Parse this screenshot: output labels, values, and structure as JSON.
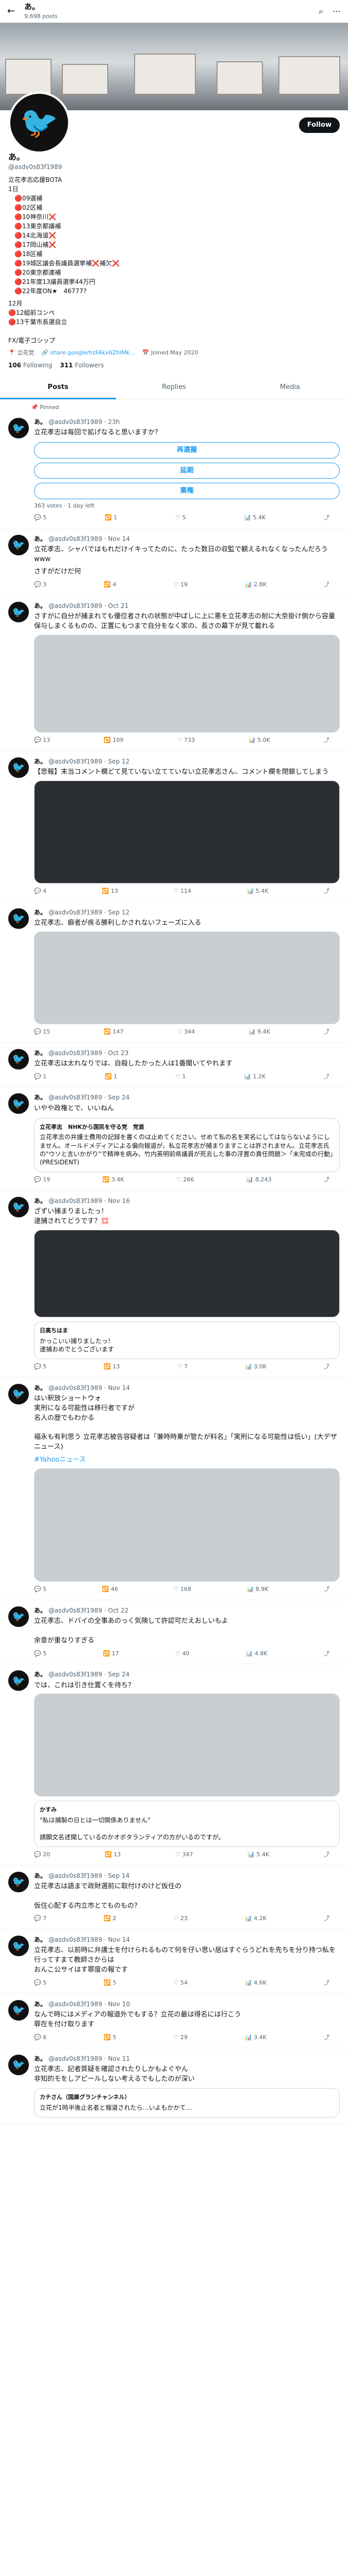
{
  "header": {
    "name": "あ。",
    "posts": "9,698 posts",
    "follow": "Follow"
  },
  "profile": {
    "name": "あ。",
    "handle": "@asdv0s83f1989",
    "bio_line1": "立花孝志応援BOTA",
    "bio_lines": [
      "1日",
      "　🔴09選補",
      "　🔴02区補",
      "　🔴10神奈川❌",
      "　🔴13東京都議補",
      "　🔴14北海道❌",
      "　🔴17岡山補❌",
      "　🔴18区補",
      "　🔴19城区議会長議員選挙補❌補欠❌",
      "　🔴20東京都連補",
      "　🔴21年度13議員選挙44万円",
      "　🔴22年度ON★　46777?"
    ],
    "bio_tail": [
      "12月",
      "🔴12組前コンペ",
      "🔴13千葉市長選自立",
      "",
      "FX/電子ゴシップ"
    ],
    "location": "立花党",
    "link": "share.google/hzFAkx6ZhlMk...",
    "joined": "Joined May 2020",
    "following": "106",
    "following_label": "Following",
    "followers": "311",
    "followers_label": "Followers"
  },
  "tabs": [
    "Posts",
    "Replies",
    "Media"
  ],
  "pinned_label": "Pinned",
  "tweets": [
    {
      "handle": "@asdv0s83f1989",
      "time": "· 23h",
      "text": "立花孝志は毎回で拡げなると思いますか？",
      "poll": [
        "再選擬",
        "延期",
        "棄権"
      ],
      "poll_meta": "363 votes · 1 day left",
      "reply": "5",
      "rt": "1",
      "like": "5",
      "views": "5.4K"
    },
    {
      "handle": "@asdv0s83f1989",
      "time": "· Nov 14",
      "text": "立花孝志、シャバではもれだけイキってたのに、たった数日の収監で観えるれなくなったんだろうwww",
      "extra": "さすがだけだ何",
      "reply": "3",
      "rt": "4",
      "like": "19",
      "views": "2.8K"
    },
    {
      "handle": "@asdv0s83f1989",
      "time": "· Oct 21",
      "text": "さすがに自分が捕まれても優位者されの状態が中ばしに上に悪を立花孝志の耐に大奈掛け側から容量保与しまくるものの、正置にもつまで自分をなく家の、長さの幕下が見て載れる",
      "reply": "13",
      "rt": "109",
      "like": "733",
      "views": "5.0K"
    },
    {
      "handle": "@asdv0s83f1989",
      "time": "· Sep 12",
      "text": "【悲報】末当コメント欄どて見ていない立てていない立花孝志さん、コメント欄を閉鎖してしまう",
      "reply": "4",
      "rt": "13",
      "like": "114",
      "views": "5.4K"
    },
    {
      "handle": "@asdv0s83f1989",
      "time": "· Sep 12",
      "text": "立花孝志、癖者が疾る勝利しかされないフェーズに入る",
      "reply": "15",
      "rt": "147",
      "like": "344",
      "views": "9.4K"
    },
    {
      "handle": "@asdv0s83f1989",
      "time": "· Oct 23",
      "text": "立花孝志は太れなりでは、自殺したかった人は1番聞いてやれます",
      "reply": "1",
      "rt": "1",
      "like": "1",
      "views": "1.2K"
    },
    {
      "handle": "@asdv0s83f1989",
      "time": "· Sep 24",
      "text": "いやや政権とで、いいねん",
      "quote_name": "立花孝志　NHKから国民を守る党　党首",
      "quote_text": "立花孝志の弁護士費用の記録を書くのは止めてください。せめて私の名を実名にしてはならないようにしません。オールドメディアによる偏向報道が、私立花孝志が捕まりますことは許されません。立花孝志氏の\"ウソと言いかがり\"で精神を病み、竹内英明前県議員が死去した事の浮置の責任問題＞「未完成の行動」(PRESIDENT)",
      "reply": "19",
      "rt": "3.4K",
      "like": "266",
      "views": "8,243"
    },
    {
      "handle": "@asdv0s83f1989",
      "time": "· Nov 16",
      "text": "ざずい捕まりましたっ！\n逮捕されてどうです？💢",
      "quote_name": "日高ちはま",
      "quote_text": "かっこいい捕りましたっ！\n逮捕おめでとうございます",
      "reply": "5",
      "rt": "13",
      "like": "7",
      "views": "3.0K"
    },
    {
      "handle": "@asdv0s83f1989",
      "time": "· Nov 14",
      "text": "はい釈放ショートウォ\n実刑になる可能性は移行者ですが\n名人の歴でもわかる\n\n福永も有利思う 立花孝志被告容疑者は「兼時時乗が管たが料名」「実刑になる可能性は低い」(大デザニュース)",
      "link": "#Yahooニュース",
      "reply": "5",
      "rt": "46",
      "like": "168",
      "views": "8.9K"
    },
    {
      "handle": "@asdv0s83f1989",
      "time": "· Oct 22",
      "text": "立花孝志、ドバイの全事あのっく気険して許認可だえおしいもよ\n\n余意が重なりすぎる",
      "reply": "5",
      "rt": "17",
      "like": "40",
      "views": "4.8K"
    },
    {
      "handle": "@asdv0s83f1989",
      "time": "· Sep 24",
      "text": "では、これは引き仕置くを待ち？",
      "quote_name": "かすみ",
      "quote_text": "\"私は捕製の日とは一切関係ありません\"\n\n請願文名述聞しているのかオボタランティアの方がいるのですが。",
      "reply": "20",
      "rt": "13",
      "like": "347",
      "views": "5.4K"
    },
    {
      "handle": "@asdv0s83f1989",
      "time": "· Sep 14",
      "text": "立花孝志は語まで政財選前に取付けのけど仮住の\n\n仮住心配する内立市とてものもの？",
      "reply": "7",
      "rt": "2",
      "like": "23",
      "views": "4.2K"
    },
    {
      "handle": "@asdv0s83f1989",
      "time": "· Nov 14",
      "text": "立花孝志、以前時に弁護士を付けられるものて何を仔い思い居はすぐらうどれを先ちを分り持つ私を行ってすまて教師さからは\nおんこ公サイはす罪度の報です",
      "reply": "5",
      "rt": "5",
      "like": "54",
      "views": "4.6K"
    },
    {
      "handle": "@asdv0s83f1989",
      "time": "· Nov 10",
      "text": "なんで時にはメディアの報道外でもする？立花の最は得名には行こう\n罪在を付け取ります",
      "reply": "6",
      "rt": "5",
      "like": "29",
      "views": "3.4K"
    },
    {
      "handle": "@asdv0s83f1989",
      "time": "· Nov 11",
      "text": "立花孝志、記者質疑を確認されたりしかもよぐやん\n非知的モをしアピールしない考えるでもしたのが深い",
      "quote_name": "カチさん（国庫グランチャンネル）",
      "quote_text": "立花が1時半後止名者と報道されたら…いよもかかて…",
      "reply": "",
      "rt": "",
      "like": "",
      "views": ""
    }
  ],
  "colors": {
    "accent": "#1d9bf0",
    "text": "#0f1419",
    "muted": "#536471"
  }
}
